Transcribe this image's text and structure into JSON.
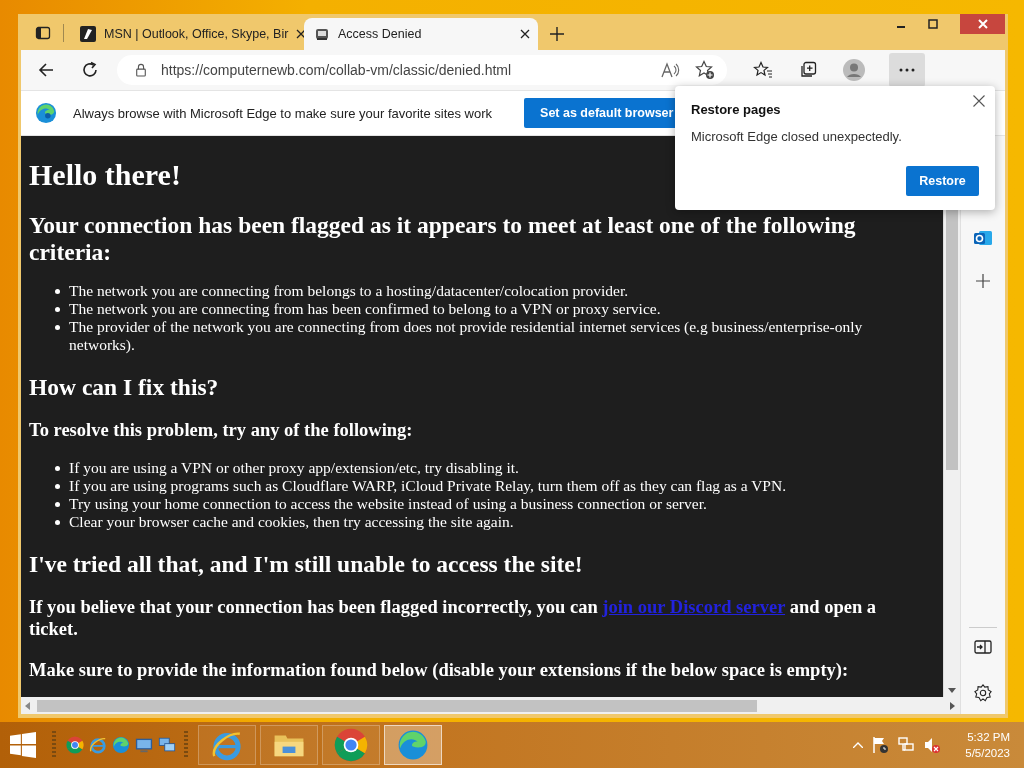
{
  "tabs": [
    {
      "title": "MSN | Outlook, Office, Skype, Bir",
      "kind": "msn",
      "selected": false
    },
    {
      "title": "Access Denied",
      "kind": "page",
      "selected": true
    }
  ],
  "address": {
    "url": "https://computernewb.com/collab-vm/classic/denied.html"
  },
  "infobar": {
    "message": "Always browse with Microsoft Edge to make sure your favorite sites work",
    "button": "Set as default browser"
  },
  "page": [
    {
      "kind": "h1",
      "text": "Hello there!"
    },
    {
      "kind": "h2",
      "text": "Your connection has been flagged as it appears to meet at least one of the following criteria:"
    },
    {
      "kind": "list",
      "items": [
        "The network you are connecting from belongs to a hosting/datacenter/colocation provider.",
        "The network you are connecting from has been confirmed to belong to a VPN or proxy service.",
        "The provider of the network you are connecting from does not provide residential internet services (e.g business/enterprise-only networks)."
      ]
    },
    {
      "kind": "h2",
      "text": "How can I fix this?"
    },
    {
      "kind": "h3",
      "text": "To resolve this problem, try any of the following:"
    },
    {
      "kind": "list",
      "items": [
        "If you are using a VPN or other proxy app/extension/etc, try disabling it.",
        "If you are using programs such as Cloudflare WARP, iCloud Private Relay, turn them off as they can flag as a VPN.",
        "Try using your home connection to access the website instead of using a business connection or server.",
        "Clear your browser cache and cookies, then try accessing the site again."
      ]
    },
    {
      "kind": "h2",
      "text": "I've tried all that, and I'm still unable to access the site!"
    },
    {
      "kind": "linkpara",
      "before": "If you believe that your connection has been flagged incorrectly, you can ",
      "link": "join our Discord server",
      "after": " and open a ticket."
    },
    {
      "kind": "h3",
      "text": "Make sure to provide the information found below (disable your extensions if the below space is empty):"
    }
  ],
  "popup": {
    "title": "Restore pages",
    "message": "Microsoft Edge closed unexpectedly.",
    "button": "Restore"
  },
  "taskbar": {
    "quick_launch": [
      {
        "kind": "chrome"
      },
      {
        "kind": "ie"
      },
      {
        "kind": "edge"
      },
      {
        "kind": "monitor"
      },
      {
        "kind": "network"
      }
    ],
    "pinned": [
      {
        "kind": "ie",
        "selected": false
      },
      {
        "kind": "explorer",
        "selected": false
      },
      {
        "kind": "chrome",
        "selected": false
      },
      {
        "kind": "edge",
        "selected": true
      }
    ],
    "time": "5:32 PM",
    "date": "5/5/2023"
  }
}
